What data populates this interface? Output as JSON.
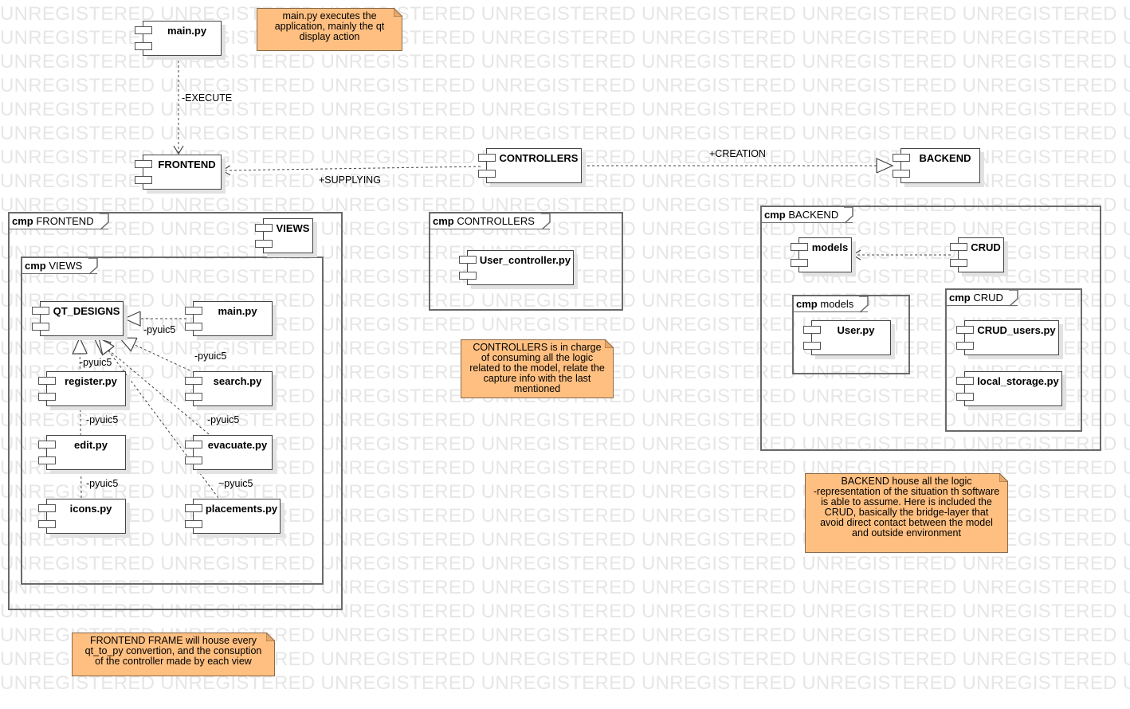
{
  "watermark": "UNREGISTERED",
  "colors": {
    "note_fill": "#ffbf80",
    "line": "#444444"
  },
  "components": {
    "main_top": "main.py",
    "frontend": "FRONTEND",
    "controllers": "CONTROLLERS",
    "backend": "BACKEND",
    "views": "VIEWS",
    "qt_designs": "QT_DESIGNS",
    "views_main": "main.py",
    "register": "register.py",
    "search": "search.py",
    "edit": "edit.py",
    "evacuate": "evacuate.py",
    "icons": "icons.py",
    "placements": "placements.py",
    "user_controller": "User_controller.py",
    "models": "models",
    "crud": "CRUD",
    "user": "User.py",
    "crud_users": "CRUD_users.py",
    "local_storage": "local_storage.py"
  },
  "frames": {
    "frontend": {
      "kw": "cmp",
      "name": "FRONTEND"
    },
    "views": {
      "kw": "cmp",
      "name": "VIEWS"
    },
    "controllers": {
      "kw": "cmp",
      "name": "CONTROLLERS"
    },
    "backend": {
      "kw": "cmp",
      "name": "BACKEND"
    },
    "models": {
      "kw": "cmp",
      "name": "models"
    },
    "crud": {
      "kw": "cmp",
      "name": "CRUD"
    }
  },
  "notes": {
    "main": "main.py executes the\napplication, mainly the qt\ndisplay action",
    "controllers": "CONTROLLERS is in charge\nof consuming all the logic\nrelated to the model, relate the\ncapture info with the last\nmentioned",
    "backend": "BACKEND house all the logic\n-representation of the situation th software\nis able to assume. Here is included the\nCRUD, basically the bridge-layer that\navoid direct contact between the model\nand outside environment",
    "frontend": "FRONTEND FRAME will house every\nqt_to_py convertion, and the consuption\nof the controller made by each view"
  },
  "edge_labels": {
    "execute": "-EXECUTE",
    "supplying": "+SUPPLYING",
    "creation": "+CREATION",
    "main_qt": "-pyuic5",
    "search_qt": "-pyuic5",
    "register_qt": "-pyuic5",
    "edit_register": "-pyuic5",
    "evacuate_qt": "-pyuic5",
    "icons_edit": "-pyuic5",
    "placements_qt": "~pyuic5"
  }
}
